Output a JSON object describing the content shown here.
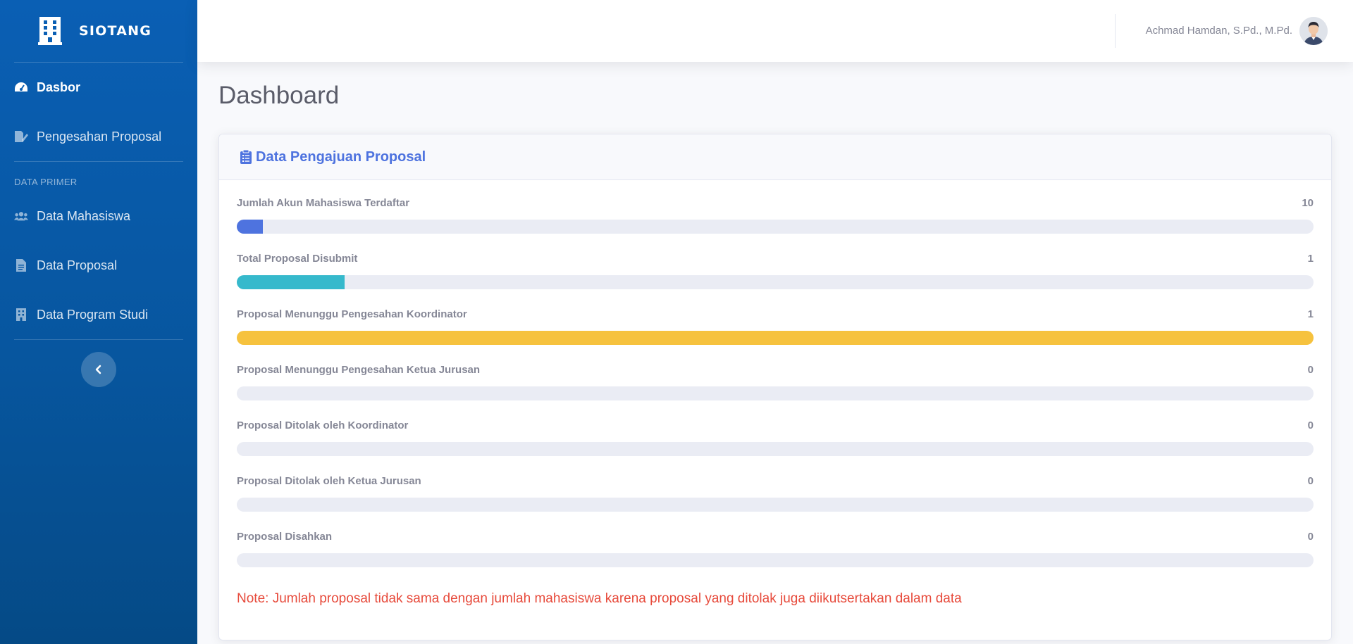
{
  "app": {
    "brand": "SIOTANG"
  },
  "sidebar": {
    "items": [
      {
        "label": "Dasbor",
        "icon": "tachometer-icon",
        "active": true
      },
      {
        "label": "Pengesahan Proposal",
        "icon": "file-signature-icon"
      }
    ],
    "section_heading": "DATA PRIMER",
    "primer_items": [
      {
        "label": "Data Mahasiswa",
        "icon": "users-icon"
      },
      {
        "label": "Data Proposal",
        "icon": "file-icon"
      },
      {
        "label": "Data Program Studi",
        "icon": "building-icon"
      }
    ],
    "toggle_icon": "chevron-left-icon"
  },
  "topbar": {
    "user_name": "Achmad Hamdan, S.Pd., M.Pd."
  },
  "page": {
    "title": "Dashboard"
  },
  "card": {
    "title": "Data Pengajuan Proposal",
    "icon": "clipboard-list-icon",
    "stats": [
      {
        "label": "Jumlah Akun Mahasiswa Terdaftar",
        "value": "10",
        "progress_pct": 2.4,
        "color": "#4e73df"
      },
      {
        "label": "Total Proposal Disubmit",
        "value": "1",
        "progress_pct": 10,
        "color": "#36b9cc"
      },
      {
        "label": "Proposal Menunggu Pengesahan Koordinator",
        "value": "1",
        "progress_pct": 100,
        "color": "#f6c23e"
      },
      {
        "label": "Proposal Menunggu Pengesahan Ketua Jurusan",
        "value": "0",
        "progress_pct": 0,
        "color": "#4e73df"
      },
      {
        "label": "Proposal Ditolak oleh Koordinator",
        "value": "0",
        "progress_pct": 0,
        "color": "#e74a3b"
      },
      {
        "label": "Proposal Ditolak oleh Ketua Jurusan",
        "value": "0",
        "progress_pct": 0,
        "color": "#e74a3b"
      },
      {
        "label": "Proposal Disahkan",
        "value": "0",
        "progress_pct": 0,
        "color": "#1cc88a"
      }
    ],
    "note": "Note: Jumlah proposal tidak sama dengan jumlah mahasiswa karena proposal yang ditolak juga diikutsertakan dalam data"
  },
  "colors": {
    "sidebar_top": "#0a5fb4",
    "sidebar_bottom": "#054a86",
    "primary": "#4e73df",
    "danger": "#e74a3b"
  }
}
